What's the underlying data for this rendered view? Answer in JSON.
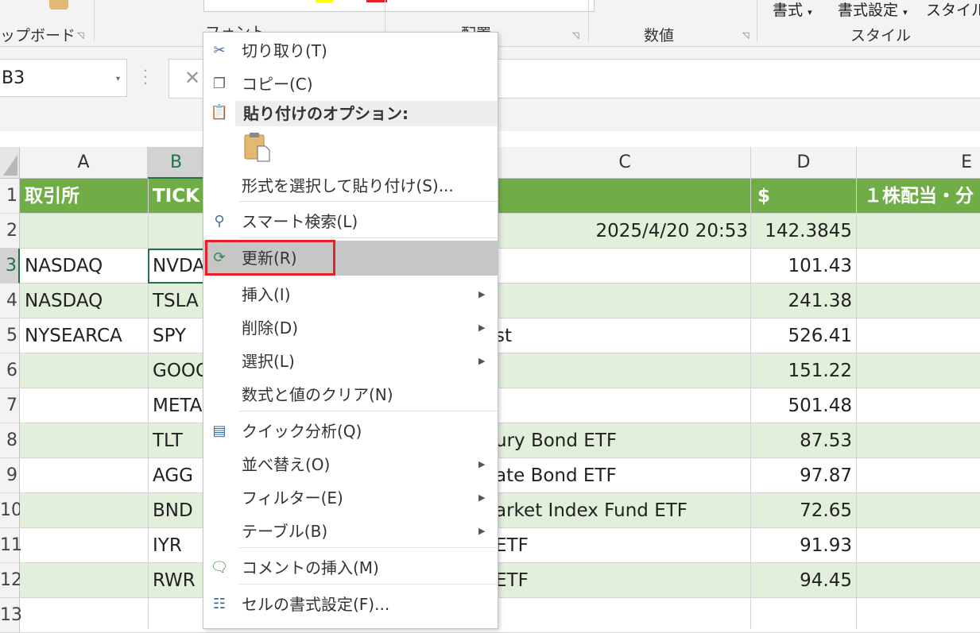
{
  "ribbon": {
    "groups": [
      {
        "label": "ップボード"
      },
      {
        "label": "フォント"
      },
      {
        "label": "配置"
      },
      {
        "label": "数値"
      },
      {
        "label": "スタイル"
      }
    ],
    "buttons": [
      "書式",
      "書式設定",
      "スタイル"
    ]
  },
  "formula_bar": {
    "name_box": "B3"
  },
  "columns": [
    "A",
    "B",
    "C",
    "D",
    "E"
  ],
  "rows": [
    {
      "n": "1",
      "a": "取引所",
      "b": "TICK",
      "c": "",
      "d": "$",
      "e": "１株配当・分"
    },
    {
      "n": "2",
      "a": "",
      "b": "",
      "c": "2025/4/20 20:53",
      "d": "142.3845",
      "e": ""
    },
    {
      "n": "3",
      "a": "NASDAQ",
      "b": "NVDA",
      "c": "",
      "d": "101.43",
      "e": ""
    },
    {
      "n": "4",
      "a": "NASDAQ",
      "b": "TSLA",
      "c": "",
      "d": "241.38",
      "e": ""
    },
    {
      "n": "5",
      "a": "NYSEARCA",
      "b": "SPY",
      "c": "st",
      "d": "526.41",
      "e": ""
    },
    {
      "n": "6",
      "a": "",
      "b": "GOOG",
      "c": "",
      "d": "151.22",
      "e": ""
    },
    {
      "n": "7",
      "a": "",
      "b": "META",
      "c": "",
      "d": "501.48",
      "e": ""
    },
    {
      "n": "8",
      "a": "",
      "b": "TLT",
      "c": "ury Bond ETF",
      "d": "87.53",
      "e": ""
    },
    {
      "n": "9",
      "a": "",
      "b": "AGG",
      "c": "ate Bond ETF",
      "d": "97.87",
      "e": ""
    },
    {
      "n": "10",
      "a": "",
      "b": "BND",
      "c": "arket Index Fund ETF",
      "d": "72.65",
      "e": ""
    },
    {
      "n": "11",
      "a": "",
      "b": "IYR",
      "c": "ETF",
      "d": "91.93",
      "e": ""
    },
    {
      "n": "12",
      "a": "",
      "b": "RWR",
      "c": "ETF",
      "d": "94.45",
      "e": ""
    },
    {
      "n": "13",
      "a": "",
      "b": "",
      "c": "",
      "d": "",
      "e": ""
    }
  ],
  "context_menu": {
    "cut": "切り取り(T)",
    "copy": "コピー(C)",
    "paste_options": "貼り付けのオプション:",
    "paste_special": "形式を選択して貼り付け(S)...",
    "smart_lookup": "スマート検索(L)",
    "refresh": "更新(R)",
    "insert": "挿入(I)",
    "delete": "削除(D)",
    "select": "選択(L)",
    "clear": "数式と値のクリア(N)",
    "quick_analysis": "クイック分析(Q)",
    "sort": "並べ替え(O)",
    "filter": "フィルター(E)",
    "table": "テーブル(B)",
    "insert_comment": "コメントの挿入(M)",
    "format_cells": "セルの書式設定(F)..."
  },
  "colors": {
    "header_green": "#70ad47",
    "band_green": "#e2efda",
    "highlight_red": "#e8202a",
    "excel_green": "#217346"
  }
}
